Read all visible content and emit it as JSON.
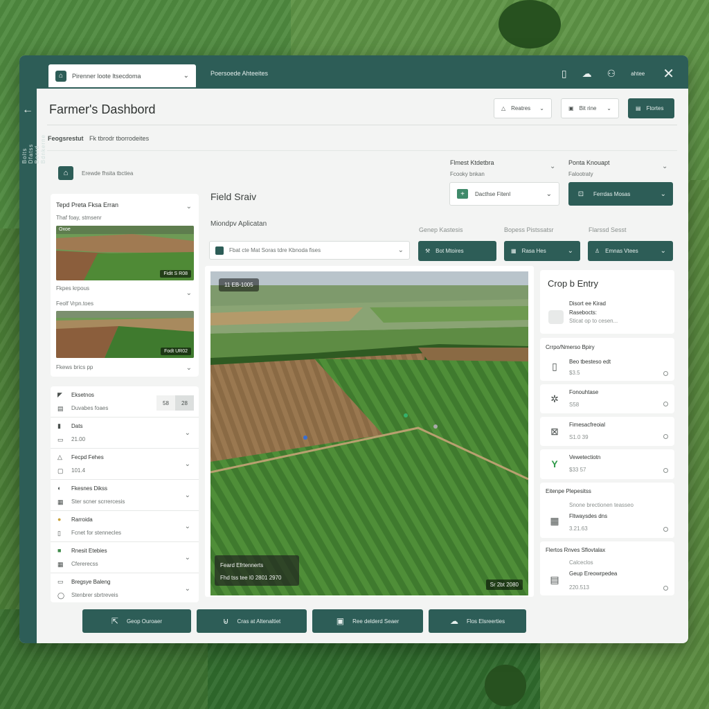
{
  "topbar": {
    "select_label": "Pirenner loote ltsecdoma",
    "link_label": "Poersoede Ahteeites",
    "user_label": "ahtee"
  },
  "sidebar": {
    "labels": [
      "Bolts",
      "Dfatss",
      "Beerd",
      "Bdnkerne"
    ]
  },
  "header": {
    "title": "Farmer's Dashbord",
    "btn_reports": "Reatres",
    "btn_bit": "Bit rine",
    "btn_primary": "Ftortes"
  },
  "breadcrumb": {
    "strong": "Feogsrestut",
    "rest": "Fk tbrodr tborrodeites"
  },
  "farm": {
    "label": "Erewde fhsita tbctiea"
  },
  "left_card": {
    "title": "Tepd Preta Fksa Erran",
    "subtitle": "Thaf foay, stmsenr",
    "thumb1_tl": "Oxoe",
    "thumb1_tag": "Fidit S R08",
    "label1": "Fkpes krpous",
    "label2": "Feolf Vrpn.toes",
    "thumb2_tag": "Fodt UR02",
    "label3": "Fkews brics pp"
  },
  "left_list": {
    "items": [
      {
        "title": "Eksetnos",
        "sub": "Duvabes foaes",
        "pill_a": "58",
        "pill_b": "28"
      },
      {
        "title": "Dats",
        "sub": "21.00"
      },
      {
        "title": "Fecpd Fehes",
        "sub": "101.4"
      },
      {
        "title": "Fkesnes Dikss",
        "sub": "Ster scner scrrercesis"
      },
      {
        "title": "Rarroida",
        "sub": "Fcnet for stennecles"
      },
      {
        "title": "Rnesit Etebies",
        "sub": "Cfererecss"
      },
      {
        "title": "Bregsye Baleng",
        "sub": "Stenbrer sbrtreveis"
      }
    ]
  },
  "field": {
    "title": "Field Sraiv",
    "subtitle": "Miondpv Aplicatan",
    "search_placeholder": "Fbat cte Mat Soras tdre Kbnoda fises",
    "dd1_label": "Flmest Ktdetbra",
    "dd1_sub": "Fcooky bnkan",
    "dd1_value": "Dacthse Fitenl",
    "dd2_label": "Ponta Knouapt",
    "dd2_sub": "Falootraty",
    "dd2_value": "Ferrdas Mosas",
    "col1": "Genep Kastesis",
    "col2": "Bopess Pistssatsr",
    "col3": "Flarssd Sesst",
    "btn1": "Bot Mtoires",
    "btn2": "Rasa Hes",
    "btn3": "Emnas Vtees"
  },
  "map": {
    "badge": "11 EB-1005",
    "overlay_title": "Feard Efrtennerts",
    "overlay_sub": "Fhd tss tee I0 2801 2970",
    "date": "Sr 2bt 2080"
  },
  "crop_entry": {
    "title": "Crop b Entry",
    "line1": "Disort ee Kirad",
    "line2": "Rasebocts:",
    "line3": "Sticat op to cesen..."
  },
  "right_list": {
    "header": "Crrpo/Nmerso Bpiry",
    "items": [
      {
        "title": "Beo tbesteso edt",
        "value": "$3.5",
        "icon": "▯"
      },
      {
        "title": "Fonouhtase",
        "value": "S58",
        "icon": "✲"
      },
      {
        "title": "Fimesacfreoial",
        "value": "S1.0 39",
        "icon": "⊠"
      },
      {
        "title": "Vewetectiotn",
        "value": "$33 57",
        "icon": "Y"
      }
    ],
    "block1_head": "Eitenpe Plepesitss",
    "block1_sub": "Snone brectionen teasseo",
    "block1_title": "Fltwaysdes dns",
    "block1_value": "3.21.63",
    "block2_head": "Flertos Rnves Sflovtalax",
    "block2_sub": "Calceclos",
    "block2_title": "Geup Ereowrpedea",
    "block2_value": "220.513"
  },
  "bottom": {
    "btn1": "Geop Ouroaer",
    "btn2": "Cras at Altenaltiet",
    "btn3": "Ree delderd Seaer",
    "btn4": "Flos Elsreerties"
  },
  "colors": {
    "accent": "#2d5d57",
    "panel": "#f3f4f3"
  }
}
